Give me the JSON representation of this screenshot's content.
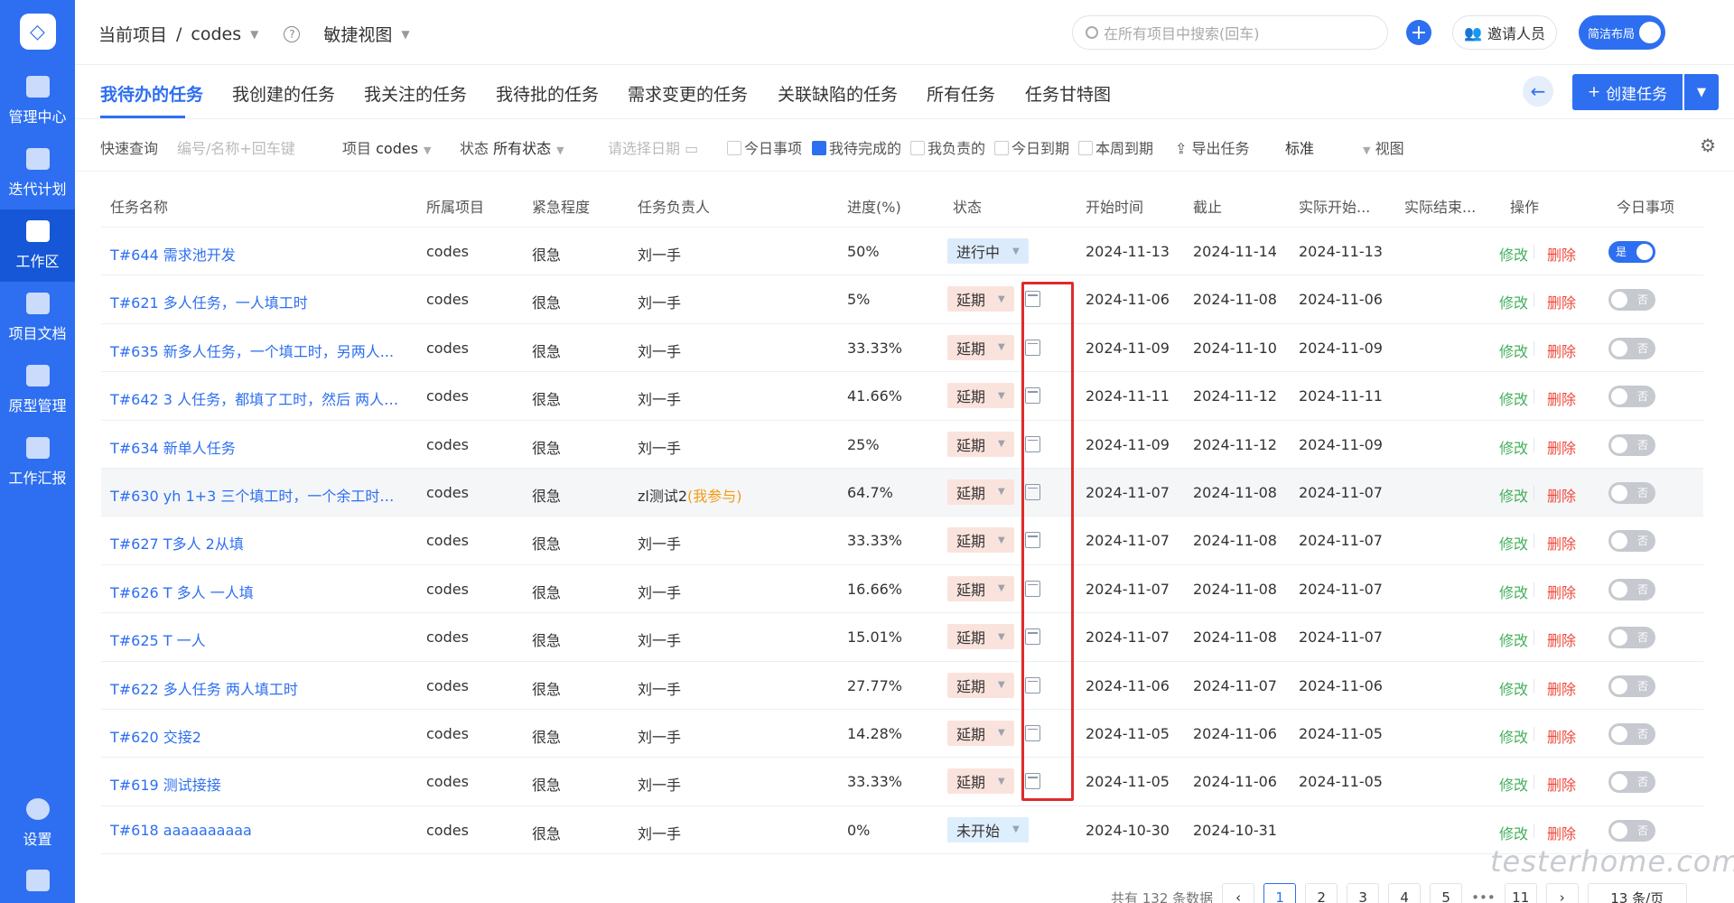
{
  "sidebar": {
    "items": [
      {
        "label": "管理中心",
        "icon": "monitor-icon"
      },
      {
        "label": "迭代计划",
        "icon": "layers-icon"
      },
      {
        "label": "工作区",
        "icon": "workspace-icon"
      },
      {
        "label": "项目文档",
        "icon": "document-icon"
      },
      {
        "label": "原型管理",
        "icon": "prototype-icon"
      },
      {
        "label": "工作汇报",
        "icon": "report-icon"
      }
    ],
    "settings_label": "设置"
  },
  "header": {
    "breadcrumb_root": "当前项目",
    "breadcrumb_sep": "/",
    "breadcrumb_project": "codes",
    "view_label": "敏捷视图",
    "search_placeholder": "在所有项目中搜索(回车)",
    "invite_label": "邀请人员",
    "compact_label": "简洁布局"
  },
  "tabs": [
    "我待办的任务",
    "我创建的任务",
    "我关注的任务",
    "我待批的任务",
    "需求变更的任务",
    "关联缺陷的任务",
    "所有任务",
    "任务甘特图"
  ],
  "actions": {
    "create_label": "创建任务"
  },
  "filters": {
    "quick_label": "快速查询",
    "quick_placeholder": "编号/名称+回车键",
    "project_label": "项目",
    "project_value": "codes",
    "status_label": "状态",
    "status_value": "所有状态",
    "date_placeholder": "请选择日期",
    "cb_today": "今日事项",
    "cb_done": "我待完成的",
    "cb_resp": "我负责的",
    "cb_due_today": "今日到期",
    "cb_due_week": "本周到期",
    "export_label": "导出任务",
    "mode_value": "标准",
    "view_label": "视图"
  },
  "table": {
    "headers": {
      "name": "任务名称",
      "project": "所属项目",
      "urgency": "紧急程度",
      "owner": "任务负责人",
      "progress": "进度(%)",
      "status": "状态",
      "start": "开始时间",
      "due": "截止",
      "actual_start": "实际开始...",
      "actual_end": "实际结束...",
      "ops": "操作",
      "today": "今日事项"
    },
    "edit_label": "修改",
    "delete_label": "删除",
    "rows": [
      {
        "name": "T#644 需求池开发",
        "project": "codes",
        "urgency": "很急",
        "owner": "刘一手",
        "owner_tag": "",
        "progress": "50%",
        "status": "进行中",
        "start": "2024-11-13",
        "due": "2024-11-14",
        "actual_start": "2024-11-13",
        "today": "是"
      },
      {
        "name": "T#621 多人任务，一人填工时",
        "project": "codes",
        "urgency": "很急",
        "owner": "刘一手",
        "owner_tag": "",
        "progress": "5%",
        "status": "延期",
        "start": "2024-11-06",
        "due": "2024-11-08",
        "actual_start": "2024-11-06",
        "today": "否"
      },
      {
        "name": "T#635 新多人任务，一个填工时，另两人...",
        "project": "codes",
        "urgency": "很急",
        "owner": "刘一手",
        "owner_tag": "",
        "progress": "33.33%",
        "status": "延期",
        "start": "2024-11-09",
        "due": "2024-11-10",
        "actual_start": "2024-11-09",
        "today": "否"
      },
      {
        "name": "T#642 3 人任务，都填了工时，然后 两人 ...",
        "project": "codes",
        "urgency": "很急",
        "owner": "刘一手",
        "owner_tag": "",
        "progress": "41.66%",
        "status": "延期",
        "start": "2024-11-11",
        "due": "2024-11-12",
        "actual_start": "2024-11-11",
        "today": "否"
      },
      {
        "name": "T#634 新单人任务",
        "project": "codes",
        "urgency": "很急",
        "owner": "刘一手",
        "owner_tag": "",
        "progress": "25%",
        "status": "延期",
        "start": "2024-11-09",
        "due": "2024-11-12",
        "actual_start": "2024-11-09",
        "today": "否"
      },
      {
        "name": "T#630 yh 1+3 三个填工时，一个余工时为...",
        "project": "codes",
        "urgency": "很急",
        "owner": "zl测试2",
        "owner_tag": "(我参与)",
        "progress": "64.7%",
        "status": "延期",
        "start": "2024-11-07",
        "due": "2024-11-08",
        "actual_start": "2024-11-07",
        "today": "否"
      },
      {
        "name": "T#627 T多人 2从填",
        "project": "codes",
        "urgency": "很急",
        "owner": "刘一手",
        "owner_tag": "",
        "progress": "33.33%",
        "status": "延期",
        "start": "2024-11-07",
        "due": "2024-11-08",
        "actual_start": "2024-11-07",
        "today": "否"
      },
      {
        "name": "T#626 T 多人 一人填",
        "project": "codes",
        "urgency": "很急",
        "owner": "刘一手",
        "owner_tag": "",
        "progress": "16.66%",
        "status": "延期",
        "start": "2024-11-07",
        "due": "2024-11-08",
        "actual_start": "2024-11-07",
        "today": "否"
      },
      {
        "name": "T#625 T 一人",
        "project": "codes",
        "urgency": "很急",
        "owner": "刘一手",
        "owner_tag": "",
        "progress": "15.01%",
        "status": "延期",
        "start": "2024-11-07",
        "due": "2024-11-08",
        "actual_start": "2024-11-07",
        "today": "否"
      },
      {
        "name": "T#622 多人任务 两人填工时",
        "project": "codes",
        "urgency": "很急",
        "owner": "刘一手",
        "owner_tag": "",
        "progress": "27.77%",
        "status": "延期",
        "start": "2024-11-06",
        "due": "2024-11-07",
        "actual_start": "2024-11-06",
        "today": "否"
      },
      {
        "name": "T#620 交接2",
        "project": "codes",
        "urgency": "很急",
        "owner": "刘一手",
        "owner_tag": "",
        "progress": "14.28%",
        "status": "延期",
        "start": "2024-11-05",
        "due": "2024-11-06",
        "actual_start": "2024-11-05",
        "today": "否"
      },
      {
        "name": "T#619 测试接接",
        "project": "codes",
        "urgency": "很急",
        "owner": "刘一手",
        "owner_tag": "",
        "progress": "33.33%",
        "status": "延期",
        "start": "2024-11-05",
        "due": "2024-11-06",
        "actual_start": "2024-11-05",
        "today": "否"
      },
      {
        "name": "T#618 aaaaaaaaaa",
        "project": "codes",
        "urgency": "很急",
        "owner": "刘一手",
        "owner_tag": "",
        "progress": "0%",
        "status": "未开始",
        "start": "2024-10-30",
        "due": "2024-10-31",
        "actual_start": "",
        "today": "否"
      }
    ]
  },
  "pagination": {
    "total_text": "共有 132 条数据",
    "pages": [
      "1",
      "2",
      "3",
      "4",
      "5",
      "•••",
      "11"
    ],
    "current": "1",
    "page_size": "13 条/页"
  },
  "watermark": "testerhome.com",
  "colors": {
    "primary": "#2d6ff0",
    "edit": "#43b05c",
    "delete": "#ef4a3c",
    "late_bg": "#fbe3dd",
    "highlight_box": "#e02a2a"
  }
}
